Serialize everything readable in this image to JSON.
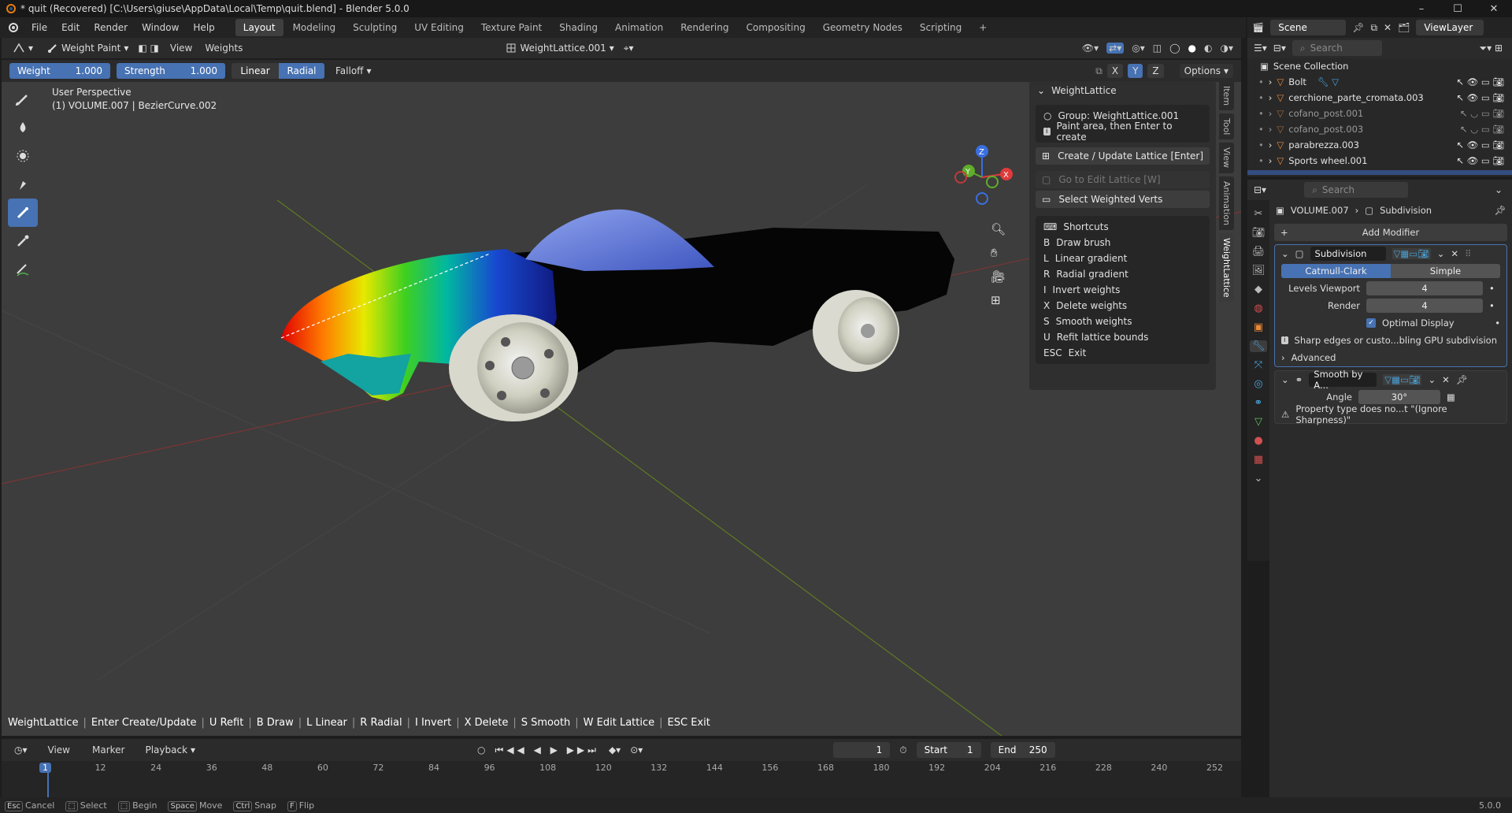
{
  "window": {
    "title": "* quit (Recovered) [C:\\Users\\giuse\\AppData\\Local\\Temp\\quit.blend] - Blender 5.0.0",
    "controls": [
      "–",
      "☐",
      "✕"
    ]
  },
  "menu": [
    "File",
    "Edit",
    "Render",
    "Window",
    "Help"
  ],
  "workspaces": [
    "Layout",
    "Modeling",
    "Sculpting",
    "UV Editing",
    "Texture Paint",
    "Shading",
    "Animation",
    "Rendering",
    "Compositing",
    "Geometry Nodes",
    "Scripting"
  ],
  "active_workspace": "Layout",
  "viewport_header": {
    "mode": "Weight Paint",
    "view": "View",
    "weights": "Weights",
    "object_data": "WeightLattice.001"
  },
  "tool_header": {
    "weight_label": "Weight",
    "weight_value": "1.000",
    "strength_label": "Strength",
    "strength_value": "1.000",
    "linear": "Linear",
    "radial": "Radial",
    "falloff": "Falloff",
    "axes": [
      "X",
      "Y",
      "Z"
    ],
    "options": "Options"
  },
  "viewport": {
    "perspective": "User Perspective",
    "object_info": "(1) VOLUME.007 | BezierCurve.002",
    "gizmo": {
      "x": "X",
      "y": "Y",
      "z": "Z"
    }
  },
  "npanel": {
    "title": "WeightLattice",
    "group": "Group: WeightLattice.001",
    "hint": "Paint area, then Enter to create",
    "create_btn": "Create / Update Lattice  [Enter]",
    "goto_btn": "Go to Edit Lattice  [W]",
    "select_btn": "Select Weighted Verts",
    "shortcuts_title": "Shortcuts",
    "shortcuts": [
      {
        "k": "B",
        "t": "Draw brush"
      },
      {
        "k": "L",
        "t": "Linear gradient"
      },
      {
        "k": "R",
        "t": "Radial gradient"
      },
      {
        "k": "I",
        "t": "Invert weights"
      },
      {
        "k": "X",
        "t": "Delete weights"
      },
      {
        "k": "S",
        "t": "Smooth weights"
      },
      {
        "k": "U",
        "t": "Refit lattice bounds"
      },
      {
        "k": "ESC",
        "t": "Exit"
      }
    ],
    "tabs": [
      "Item",
      "Tool",
      "View",
      "Animation",
      "WeightLattice"
    ]
  },
  "hint_bar": [
    "WeightLattice",
    "Enter Create/Update",
    "U Refit",
    "B Draw",
    "L Linear",
    "R Radial",
    "I Invert",
    "X Delete",
    "S Smooth",
    "W Edit Lattice",
    "ESC Exit"
  ],
  "timeline": {
    "view": "View",
    "marker": "Marker",
    "playback": "Playback",
    "current_frame": "1",
    "start_label": "Start",
    "start": "1",
    "end_label": "End",
    "end": "250",
    "ticks": [
      "1",
      "12",
      "24",
      "36",
      "48",
      "60",
      "72",
      "84",
      "96",
      "108",
      "120",
      "132",
      "144",
      "156",
      "168",
      "180",
      "192",
      "204",
      "216",
      "228",
      "240",
      "252"
    ]
  },
  "statusbar": [
    {
      "key": "Esc",
      "label": "Cancel"
    },
    {
      "key": "⬚",
      "label": "Select"
    },
    {
      "key": "⬚",
      "label": "Begin"
    },
    {
      "key": "Space",
      "label": "Move"
    },
    {
      "key": "Ctrl",
      "label": "Snap"
    },
    {
      "key": "F",
      "label": "Flip"
    }
  ],
  "version": "5.0.0",
  "right_header": {
    "scene": "Scene",
    "view_layer": "ViewLayer"
  },
  "outliner": {
    "search_placeholder": "Search",
    "collection": "Scene Collection",
    "items": [
      {
        "name": "Bolt",
        "dim": false
      },
      {
        "name": "cerchione_parte_cromata.003",
        "dim": false
      },
      {
        "name": "cofano_post.001",
        "dim": true
      },
      {
        "name": "cofano_post.003",
        "dim": true
      },
      {
        "name": "parabrezza.003",
        "dim": false
      },
      {
        "name": "Sports wheel.001",
        "dim": false
      }
    ]
  },
  "properties": {
    "search_placeholder": "Search",
    "breadcrumb_object": "VOLUME.007",
    "breadcrumb_modifier": "Subdivision",
    "add_modifier": "Add Modifier",
    "subdivision": {
      "name": "Subdivision",
      "catmull": "Catmull-Clark",
      "simple": "Simple",
      "levels_label": "Levels Viewport",
      "levels": "4",
      "render_label": "Render",
      "render": "4",
      "optimal": "Optimal Display",
      "info": "Sharp edges or custo...bling GPU subdivision",
      "advanced": "Advanced"
    },
    "smooth": {
      "name": "Smooth by A...",
      "angle_label": "Angle",
      "angle": "30°",
      "warning": "Property type does no...t \"(Ignore Sharpness)\""
    }
  },
  "colors": {
    "accent": "#4772b3",
    "bg": "#3d3d3d",
    "panel": "#2b2b2b"
  }
}
